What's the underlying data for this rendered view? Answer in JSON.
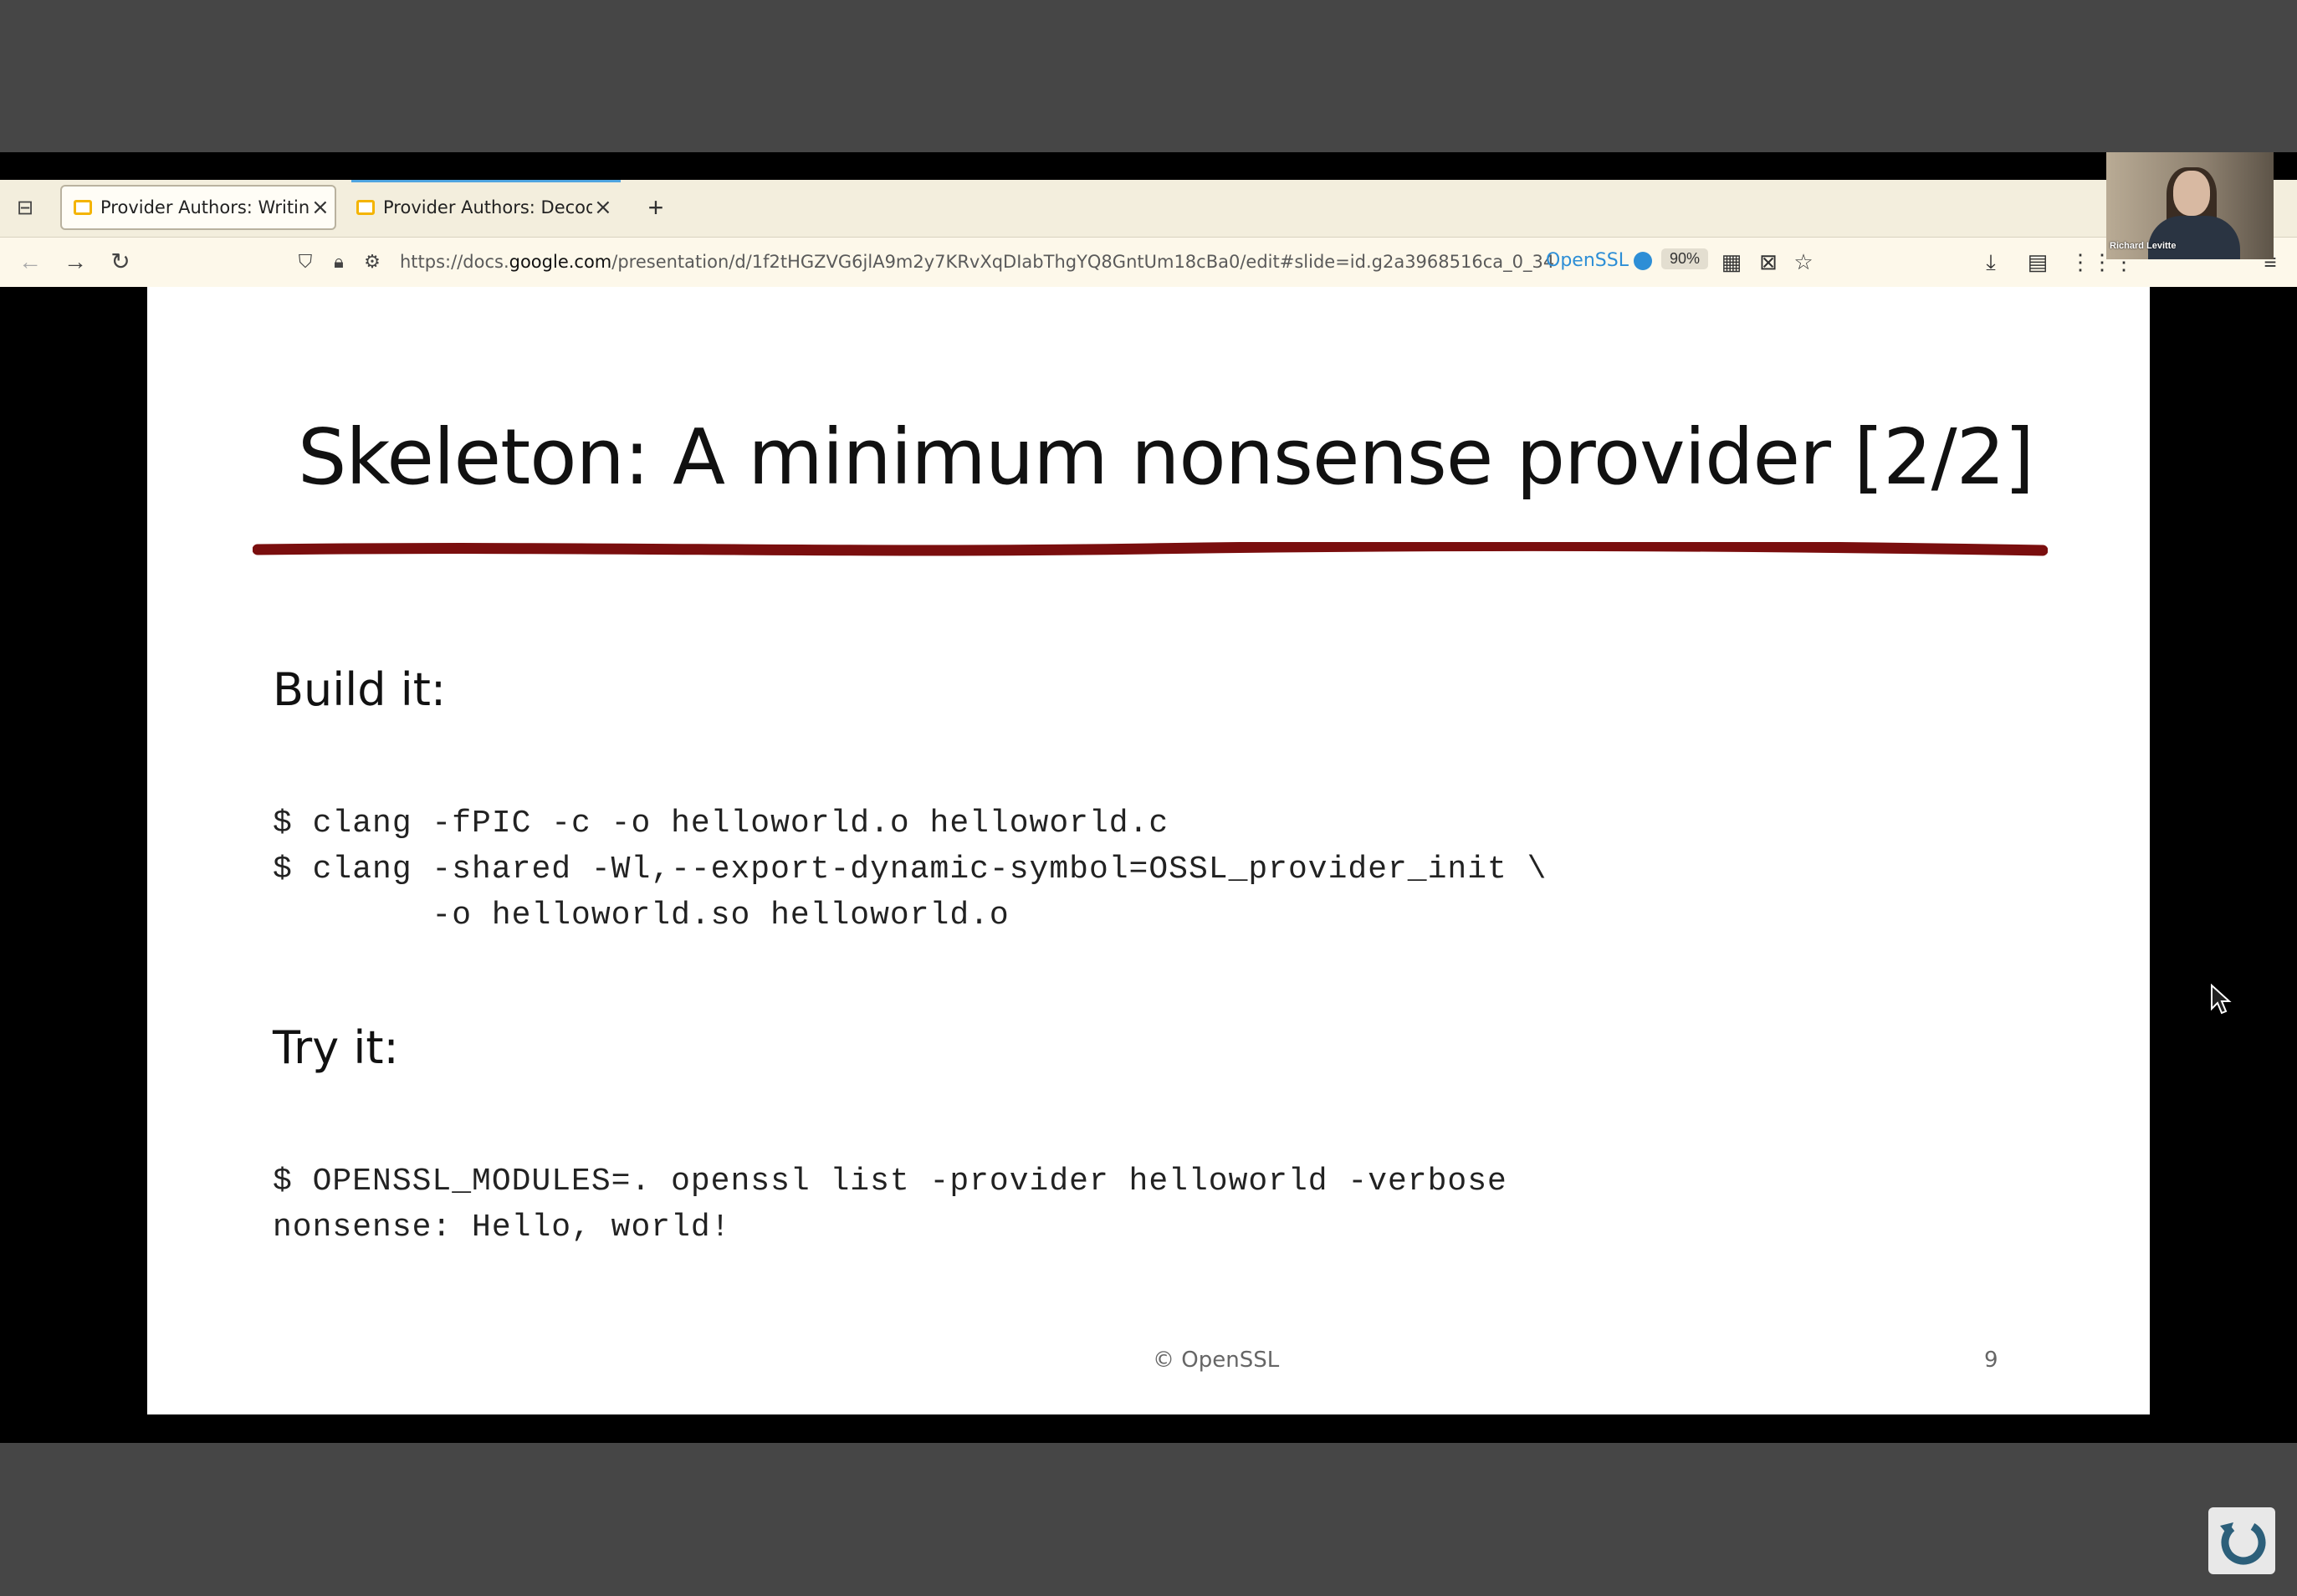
{
  "browser": {
    "tabs": [
      {
        "title": "Provider Authors: Writing a",
        "active": true
      },
      {
        "title": "Provider Authors: Decoder",
        "active": false
      }
    ],
    "url": {
      "prefix": "https://docs.",
      "host": "google.com",
      "path": "/presentation/d/1f2tHGZVG6jlA9m2y7KRvXqDIabThgYQ8GntUm18cBa0/edit#slide=id.g2a3968516ca_0_34"
    },
    "bookmark_label": "OpenSSL",
    "zoom": "90%"
  },
  "webcam": {
    "name": "Richard Levitte"
  },
  "slide": {
    "title": "Skeleton: A minimum nonsense provider [2/2]",
    "build_heading": "Build it:",
    "build_lines": [
      "$ clang -fPIC -c -o helloworld.o helloworld.c",
      "$ clang -shared -Wl,--export-dynamic-symbol=OSSL_provider_init \\",
      "        -o helloworld.so helloworld.o"
    ],
    "try_heading": "Try it:",
    "try_lines": [
      "$ OPENSSL_MODULES=. openssl list -provider helloworld -verbose",
      "nonsense: Hello, world!"
    ],
    "footer": "© OpenSSL",
    "page_number": "9"
  },
  "colors": {
    "rule": "#7a0e0e",
    "accent": "#2d8ed6"
  }
}
